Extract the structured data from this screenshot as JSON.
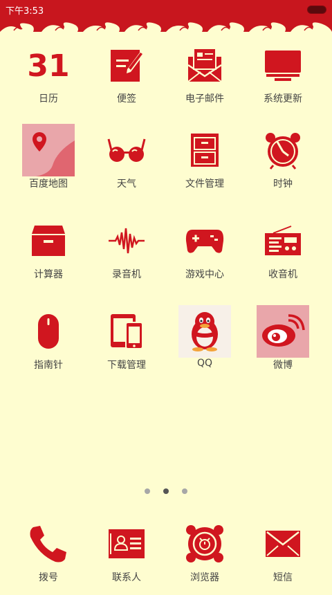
{
  "status_bar": {
    "time": "下午3:53"
  },
  "apps": [
    {
      "id": "calendar",
      "label": "日历",
      "icon": "calendar-31-icon"
    },
    {
      "id": "notes",
      "label": "便签",
      "icon": "notes-pen-icon"
    },
    {
      "id": "email",
      "label": "电子邮件",
      "icon": "envelope-letter-icon"
    },
    {
      "id": "update",
      "label": "系统更新",
      "icon": "monitor-icon"
    },
    {
      "id": "baidu-map",
      "label": "百度地图",
      "icon": "map-pin-icon"
    },
    {
      "id": "weather",
      "label": "天气",
      "icon": "sunglasses-icon"
    },
    {
      "id": "files",
      "label": "文件管理",
      "icon": "cabinet-icon"
    },
    {
      "id": "clock",
      "label": "时钟",
      "icon": "alarm-clock-icon"
    },
    {
      "id": "calculator",
      "label": "计算器",
      "icon": "box-icon"
    },
    {
      "id": "recorder",
      "label": "录音机",
      "icon": "waveform-icon"
    },
    {
      "id": "game-center",
      "label": "游戏中心",
      "icon": "gamepad-icon"
    },
    {
      "id": "radio",
      "label": "收音机",
      "icon": "radio-icon"
    },
    {
      "id": "compass",
      "label": "指南针",
      "icon": "mouse-icon"
    },
    {
      "id": "downloads",
      "label": "下载管理",
      "icon": "devices-icon"
    },
    {
      "id": "qq",
      "label": "QQ",
      "icon": "qq-penguin-icon"
    },
    {
      "id": "weibo",
      "label": "微博",
      "icon": "weibo-eye-icon"
    }
  ],
  "page_indicator": {
    "count": 3,
    "active": 1
  },
  "dock": [
    {
      "id": "dialer",
      "label": "拨号",
      "icon": "phone-icon"
    },
    {
      "id": "contacts",
      "label": "联系人",
      "icon": "contact-card-icon"
    },
    {
      "id": "browser",
      "label": "浏览器",
      "icon": "browser-speaker-icon"
    },
    {
      "id": "sms",
      "label": "短信",
      "icon": "envelope-icon"
    }
  ],
  "colors": {
    "accent": "#d0161f",
    "background": "#fefdd0"
  }
}
